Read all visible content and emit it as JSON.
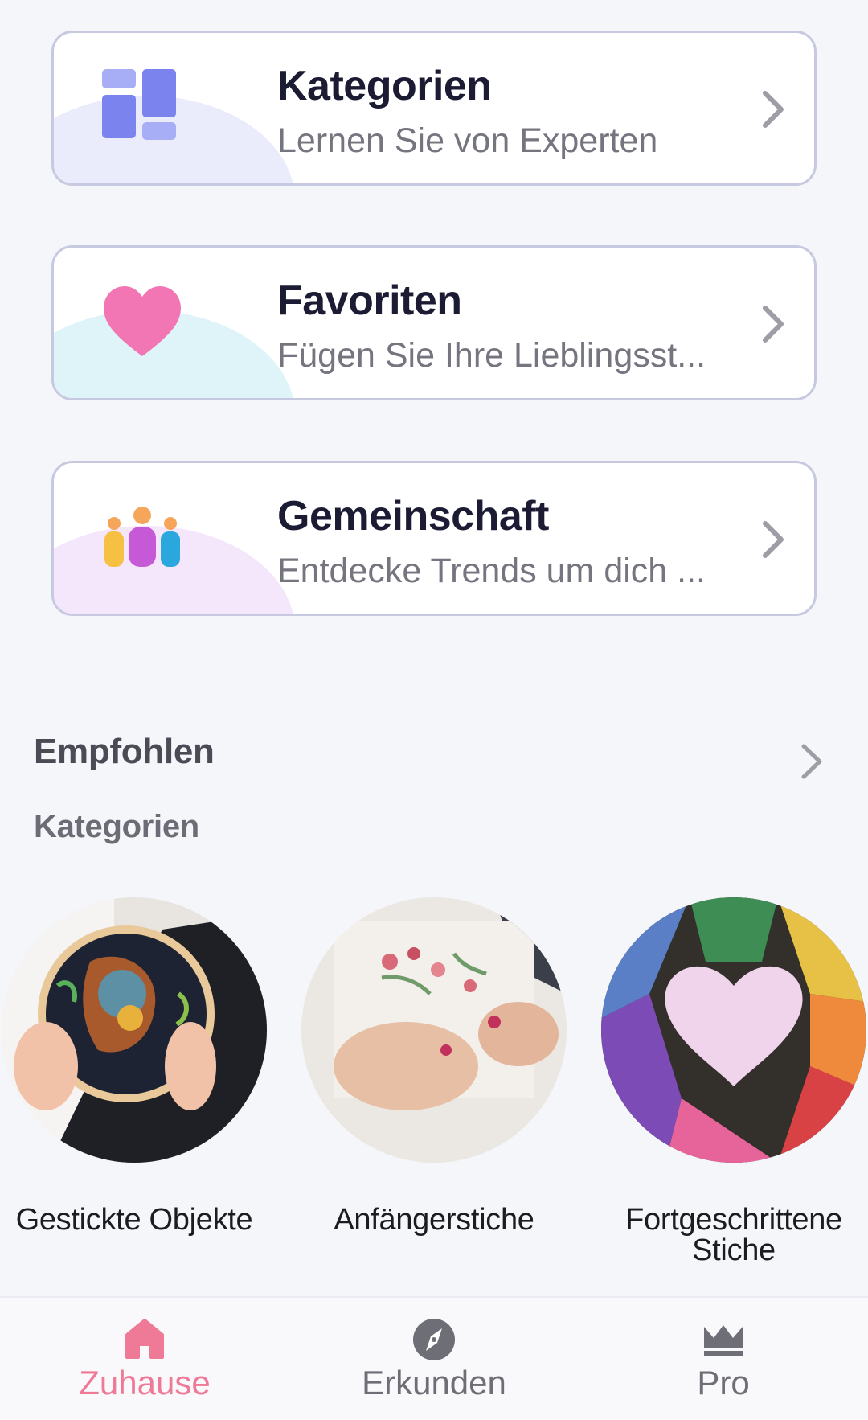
{
  "cards": [
    {
      "title": "Kategorien",
      "subtitle": "Lernen Sie von Experten",
      "icon": "grid-blocks-icon"
    },
    {
      "title": "Favoriten",
      "subtitle": "Fügen Sie Ihre Lieblingsst...",
      "icon": "heart-icon"
    },
    {
      "title": "Gemeinschaft",
      "subtitle": "Entdecke Trends um dich ...",
      "icon": "people-group-icon"
    }
  ],
  "recommended": {
    "title": "Empfohlen",
    "subtitle": "Kategorien"
  },
  "categories": [
    {
      "label": "Gestickte Objekte",
      "image": "embroidery-hoop-photo"
    },
    {
      "label": "Anfängerstiche",
      "image": "hands-cross-stitch-photo"
    },
    {
      "label": "Fortgeschrittene Stiche",
      "image": "thread-heart-photo"
    }
  ],
  "nav": [
    {
      "label": "Zuhause",
      "icon": "home-icon",
      "active": true
    },
    {
      "label": "Erkunden",
      "icon": "compass-icon",
      "active": false
    },
    {
      "label": "Pro",
      "icon": "crown-icon",
      "active": false
    }
  ],
  "colors": {
    "accent": "#ef7a97",
    "title": "#1b1c33",
    "subtitle": "#74757f",
    "card_border": "#c6c9e0",
    "background": "#f5f6fa"
  }
}
